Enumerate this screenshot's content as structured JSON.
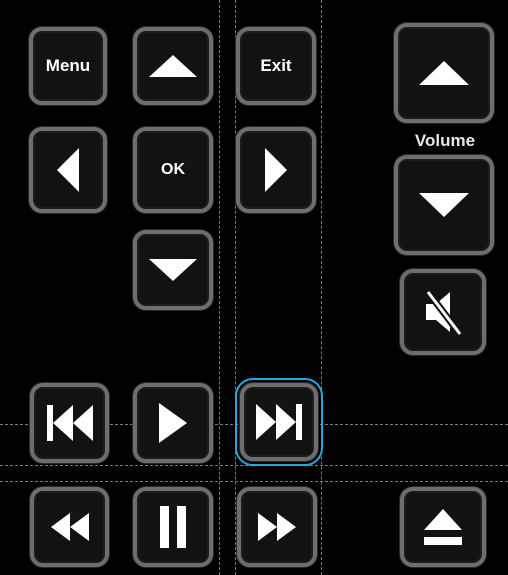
{
  "buttons": {
    "menu_label": "Menu",
    "exit_label": "Exit",
    "ok_label": "OK"
  },
  "volume": {
    "label": "Volume"
  },
  "icons": {
    "up": "arrow-up-icon",
    "down": "arrow-down-icon",
    "left": "arrow-left-icon",
    "right": "arrow-right-icon",
    "mute": "mute-icon",
    "previous": "skip-previous-icon",
    "play": "play-icon",
    "next": "skip-next-icon",
    "rewind": "rewind-icon",
    "pause": "pause-icon",
    "fast_forward": "fast-forward-icon",
    "eject": "eject-icon"
  },
  "colors": {
    "background": "#000000",
    "button_border": "#6e6e6e",
    "button_fill": "#121212",
    "selection": "#22a8e0",
    "guide": "#7a7a7a"
  },
  "selected_button": "skip-next-button"
}
